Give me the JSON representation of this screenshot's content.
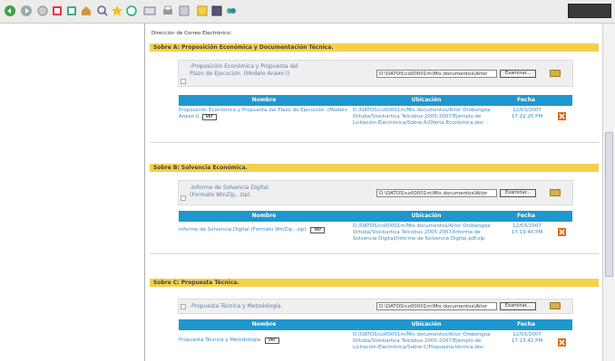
{
  "toolbar": {
    "icons": [
      "back-icon",
      "forward-icon",
      "stop-icon",
      "refresh-icon",
      "home-icon",
      "search-icon",
      "favorites-icon",
      "media-icon",
      "history-icon",
      "mail-icon",
      "print-icon",
      "edit-icon",
      "discuss-icon",
      "messenger-icon"
    ]
  },
  "page": {
    "title": "Dirección de Correo Electrónico:"
  },
  "sections": [
    {
      "header": "Sobre A: Proposición Económica y Documentación Técnica.",
      "upload_label": "-Proposición Económica y Propuesta del Plazo de Ejecución. (Modelo Anexo I)",
      "path": "D:\\DATOS\\co00001m\\Mis documentos\\Aitor",
      "browse": "Examinar...",
      "columns": [
        "Nombre",
        "Ubicación",
        "Fecha"
      ],
      "row": {
        "nombre": "Proposición Económica y Propuesta del Plazo de Ejecución. (Modelo Anexo I)",
        "ver": "Ver",
        "ubicacion": "D:/DATOS/co00001m/Mis documentos/Aitor Orobengoa Ortuba/Stockartica Telcobus 2005-2007/Ejemplo de Licitación Electrónica/Sobre A/Oferta Económica.doc",
        "fecha": "12/03/2007 17:22:20 PM"
      }
    },
    {
      "header": "Sobre B: Solvencia Económica.",
      "upload_label": "-Informe de Solvencia Digital (Formato WinZip, .zip).",
      "path": "D:\\DATOS\\co00001m\\Mis documentos\\Aitor",
      "browse": "Examinar...",
      "columns": [
        "Nombre",
        "Ubicación",
        "Fecha"
      ],
      "row": {
        "nombre": "Informe de Solvencia Digital (Formato WinZip, .zip).",
        "ver": "Ver",
        "ubicacion": "D:/DATOS/co00001m/Mis documentos/Aitor Orobengoa Ortuba/Stockartica Telcobus 2005-2007/Informe de Solvencia Digital/Informe de Solvencia Digital.pdf.zip",
        "fecha": "12/03/2007 17:19:40 PM"
      }
    },
    {
      "header": "Sobre C: Propuesta Técnica.",
      "upload_label": "-Propuesta Técnica y Metodología.",
      "path": "D:\\DATOS\\co00001m\\Mis documentos\\Aitor",
      "browse": "Examinar...",
      "columns": [
        "Nombre",
        "Ubicación",
        "Fecha"
      ],
      "row": {
        "nombre": "Propuesta Técnica y Metodología.",
        "ver": "Ver",
        "ubicacion": "D:/DATOS/co00001m/Mis documentos/Aitor Orobengoa Ortuba/Stockartica Telcobus 2005-2007/Ejemplo de Licitación Electrónica/Sobre C/Propuesta técnica.doc",
        "fecha": "12/03/2007 17:23:42 PM"
      }
    }
  ]
}
